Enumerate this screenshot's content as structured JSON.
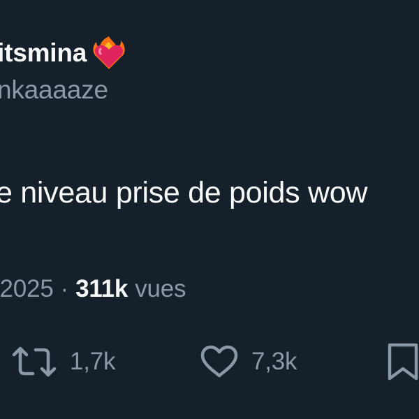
{
  "tweet": {
    "display_name": "itsmina",
    "handle": "nkaaaaze",
    "text": "e niveau prise de poids wow",
    "date": "/2025",
    "meta_separator": "·",
    "view_count": "311k",
    "view_label": "vues"
  },
  "actions": {
    "retweet_count": "1,7k",
    "like_count": "7,3k"
  },
  "icons": {
    "display_name_badge": "heart-on-fire-emoji",
    "retweet": "retweet-icon",
    "like": "heart-outline-icon",
    "bookmark": "bookmark-icon"
  },
  "colors": {
    "background": "#15202b",
    "primary_text": "#f7f9f9",
    "secondary_text": "#8b98a5"
  }
}
